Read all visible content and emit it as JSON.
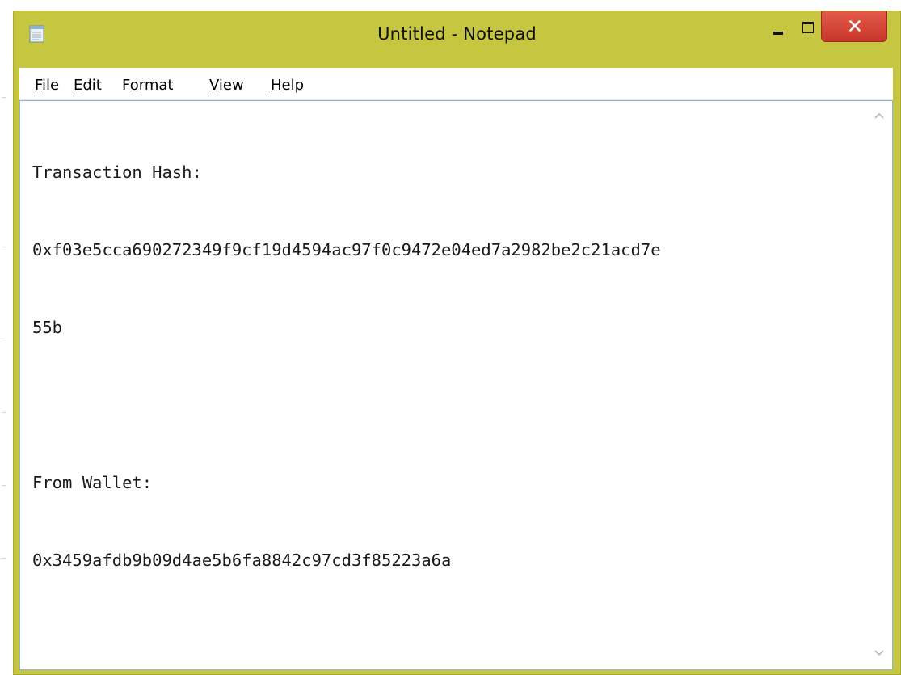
{
  "window": {
    "title": "Untitled - Notepad"
  },
  "icons": {
    "app": "notepad-icon",
    "minimize": "minimize-icon",
    "maximize": "maximize-icon",
    "close": "close-icon",
    "scroll_up": "chevron-up-icon",
    "scroll_down": "chevron-down-icon"
  },
  "menu": {
    "items": [
      {
        "accel": "F",
        "rest": "ile"
      },
      {
        "accel": "E",
        "rest": "dit"
      },
      {
        "pre": "F",
        "accel": "o",
        "rest": "rmat"
      },
      {
        "accel": "V",
        "rest": "iew"
      },
      {
        "accel": "H",
        "rest": "elp"
      }
    ]
  },
  "editor": {
    "lines": [
      "Transaction Hash:",
      "0xf03e5cca690272349f9cf19d4594ac97f0c9472e04ed7a2982be2c21acd7e",
      "55b",
      "",
      "From Wallet:",
      "0x3459afdb9b09d4ae5b6fa8842c97cd3f85223a6a"
    ]
  },
  "colors": {
    "titlebar": "#c6c640",
    "close_button": "#c7372a",
    "editor_border": "#8ab6dc"
  }
}
